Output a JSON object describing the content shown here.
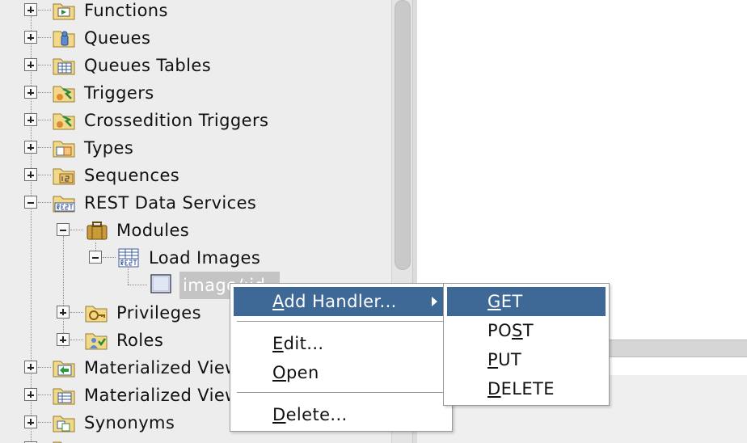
{
  "tree": {
    "items": [
      {
        "label": "Functions",
        "icon": "functions-folder-icon"
      },
      {
        "label": "Queues",
        "icon": "queues-folder-icon"
      },
      {
        "label": "Queues Tables",
        "icon": "queues-tables-folder-icon"
      },
      {
        "label": "Triggers",
        "icon": "triggers-folder-icon"
      },
      {
        "label": "Crossedition Triggers",
        "icon": "crossedition-triggers-folder-icon"
      },
      {
        "label": "Types",
        "icon": "types-folder-icon"
      },
      {
        "label": "Sequences",
        "icon": "sequences-folder-icon"
      },
      {
        "label": "REST Data Services",
        "icon": "rest-folder-icon"
      },
      {
        "label": "Modules",
        "icon": "modules-briefcase-icon"
      },
      {
        "label": "Load Images",
        "icon": "rest-module-icon"
      },
      {
        "label": "image/:id",
        "icon": "template-icon"
      },
      {
        "label": "Privileges",
        "icon": "privileges-folder-icon"
      },
      {
        "label": "Roles",
        "icon": "roles-folder-icon"
      },
      {
        "label": "Materialized Views",
        "icon": "materialized-views-folder-icon"
      },
      {
        "label": "Materialized View Logs",
        "icon": "materialized-view-logs-folder-icon"
      },
      {
        "label": "Synonyms",
        "icon": "synonyms-folder-icon"
      }
    ]
  },
  "context_menu": {
    "add_handler": {
      "accel": "A",
      "rest": "dd Handler..."
    },
    "edit": {
      "accel": "E",
      "rest": "dit..."
    },
    "open": {
      "accel": "O",
      "rest": "pen"
    },
    "delete": {
      "accel": "D",
      "rest": "elete..."
    }
  },
  "submenu": {
    "get": {
      "accel": "G",
      "rest": "ET"
    },
    "post": {
      "pre": "PO",
      "accel": "S",
      "rest": "T"
    },
    "put": {
      "accel": "P",
      "rest": "UT"
    },
    "delete": {
      "accel": "D",
      "rest": "ELETE"
    }
  },
  "colors": {
    "menu_highlight": "#3e6896",
    "tree_background": "#ededed",
    "selection": "#c4c4c4"
  }
}
